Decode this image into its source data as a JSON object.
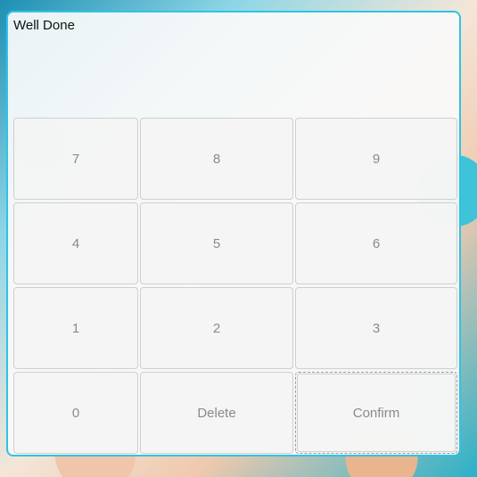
{
  "dialog": {
    "message": "Well Done"
  },
  "keypad": {
    "keys": [
      "7",
      "8",
      "9",
      "4",
      "5",
      "6",
      "1",
      "2",
      "3",
      "0",
      "Delete",
      "Confirm"
    ]
  }
}
